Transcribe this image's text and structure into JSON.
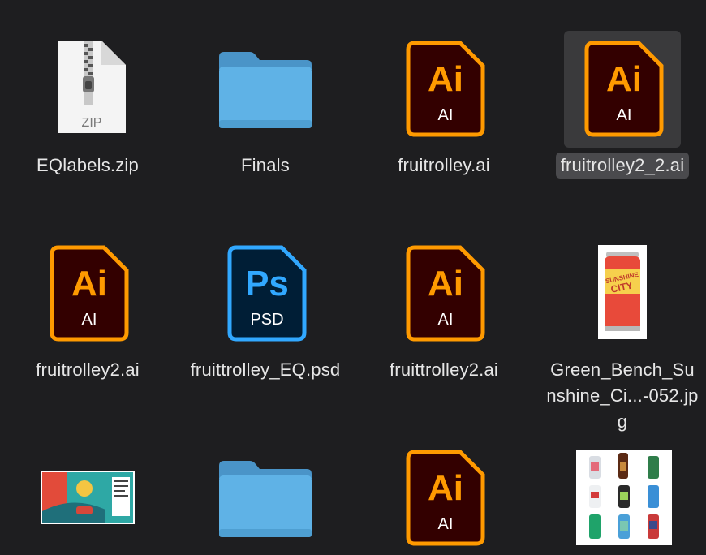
{
  "items": [
    {
      "name": "EQlabels.zip",
      "kind": "zip",
      "badge": "ZIP"
    },
    {
      "name": "Finals",
      "kind": "folder"
    },
    {
      "name": "fruitrolley.ai",
      "kind": "ai",
      "logo": "Ai",
      "badge": "AI"
    },
    {
      "name": "fruitrolley2_2.ai",
      "kind": "ai",
      "logo": "Ai",
      "badge": "AI",
      "selected": true
    },
    {
      "name": "fruitrolley2.ai",
      "kind": "ai",
      "logo": "Ai",
      "badge": "AI"
    },
    {
      "name": "fruittrolley_EQ.psd",
      "kind": "psd",
      "logo": "Ps",
      "badge": "PSD"
    },
    {
      "name": "fruittrolley2.ai",
      "kind": "ai",
      "logo": "Ai",
      "badge": "AI"
    },
    {
      "name": "Green_Bench_Sunshine_Ci...-052.jpg",
      "kind": "jpg-can"
    },
    {
      "name": "",
      "kind": "jpg-label"
    },
    {
      "name": "",
      "kind": "folder"
    },
    {
      "name": "",
      "kind": "ai",
      "logo": "Ai",
      "badge": "AI"
    },
    {
      "name": "",
      "kind": "jpg-grid"
    }
  ],
  "can_text": "SUNSHINE CITY",
  "colors": {
    "background": "#1e1e20",
    "ai_orange": "#ff9a00",
    "ai_dark": "#330000",
    "ps_blue": "#31a8ff",
    "ps_dark": "#001e36",
    "folder": "#5fb2e6"
  }
}
